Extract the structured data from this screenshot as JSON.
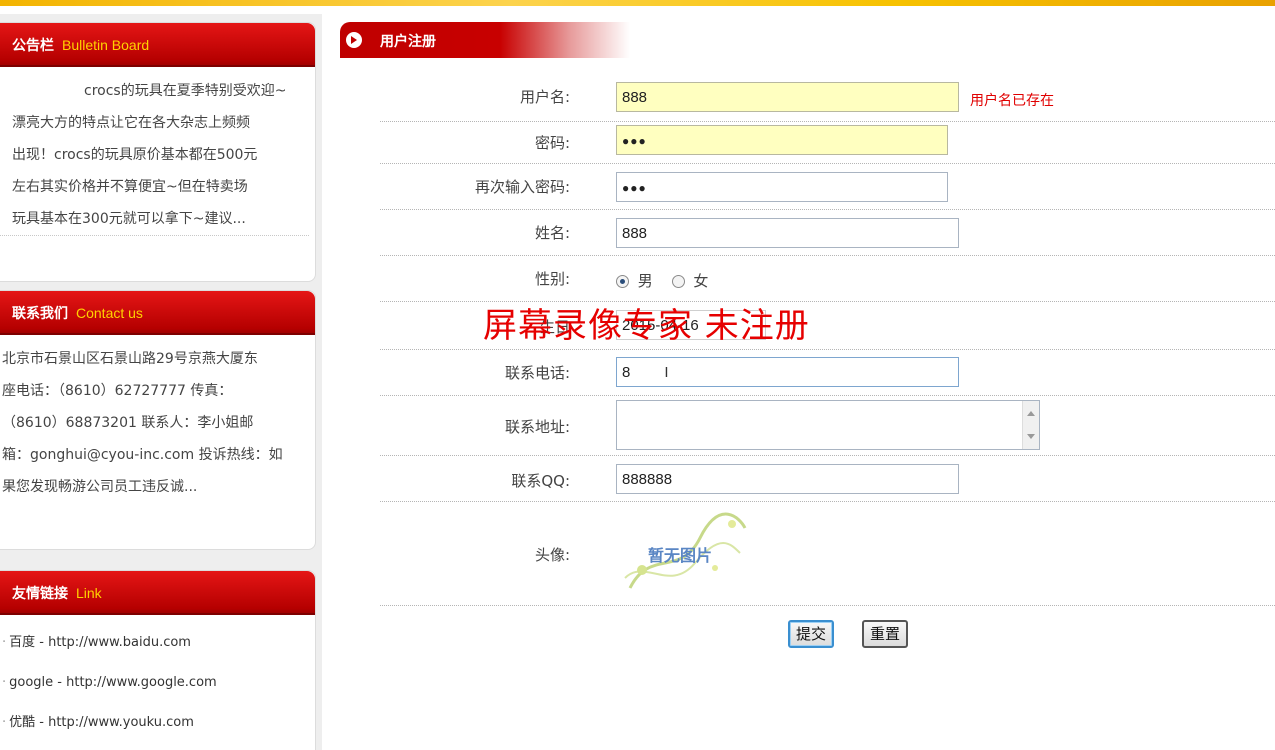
{
  "bulletin": {
    "title_cn": "公告栏",
    "title_en": "Bulletin Board",
    "lines": [
      "crocs的玩具在夏季特别受欢迎~",
      "漂亮大方的特点让它在各大杂志上频频",
      "出现！crocs的玩具原价基本都在500元",
      "左右其实价格并不算便宜~但在特卖场",
      "玩具基本在300元就可以拿下~建议..."
    ]
  },
  "contact": {
    "title_cn": "联系我们",
    "title_en": "Contact us",
    "lines": [
      "北京市石景山区石景山路29号京燕大厦东",
      "座电话：（8610）62727777 传真：",
      "（8610）68873201 联系人：李小姐邮",
      "箱：gonghui@cyou-inc.com 投诉热线：如",
      "果您发现畅游公司员工违反诚..."
    ]
  },
  "links": {
    "title_cn": "友情链接",
    "title_en": "Link",
    "items": [
      "百度  - http://www.baidu.com",
      "google - http://www.google.com",
      "优酷  - http://www.youku.com"
    ]
  },
  "main": {
    "title": "用户注册",
    "username": {
      "label": "用户名:",
      "value": "888",
      "error": "用户名已存在"
    },
    "password": {
      "label": "密码:",
      "value": "●●●"
    },
    "password2": {
      "label": "再次输入密码:",
      "value": "●●●"
    },
    "name": {
      "label": "姓名:",
      "value": "888"
    },
    "gender": {
      "label": "性别:",
      "male": "男",
      "female": "女",
      "selected": "男"
    },
    "birthday": {
      "label": "生日",
      "value": "2015-04-16"
    },
    "phone": {
      "label": "联系电话:",
      "value": "8"
    },
    "address": {
      "label": "联系地址:",
      "value": ""
    },
    "qq": {
      "label": "联系QQ:",
      "value": "888888"
    },
    "avatar": {
      "label": "头像:",
      "placeholder": "暂无图片"
    },
    "submit_label": "提交",
    "reset_label": "重置"
  },
  "watermark": "屏幕录像专家  未注册",
  "colors": {
    "header_red": "#bf0000",
    "accent_yellow": "#ffd200",
    "error_red": "#e00000"
  }
}
